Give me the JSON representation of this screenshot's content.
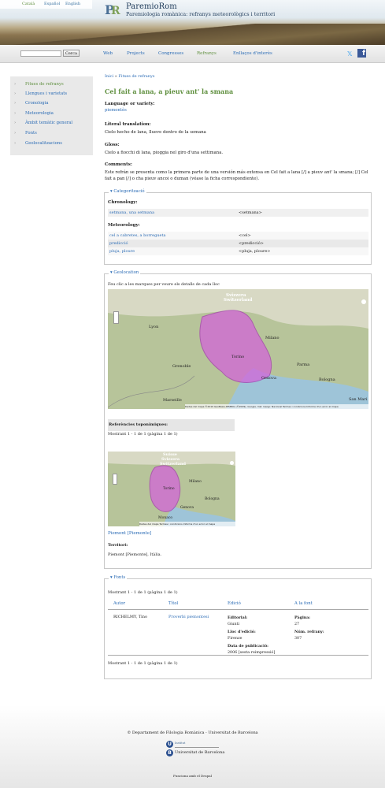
{
  "langs": [
    "Català",
    "Español",
    "English"
  ],
  "site": {
    "name": "ParemioRom",
    "slogan": "Paremiologia romànica: refranys meteorològics i territori"
  },
  "search_button": "Cerca",
  "nav": [
    "Web",
    "Projects",
    "Congresses",
    "Refranys",
    "Enllaços d'interès"
  ],
  "social": {
    "twitter": "ὂ6",
    "facebook": "f"
  },
  "sidebar": [
    "Fitxes de refranys",
    "Llengues i varietats",
    "Cronologia",
    "Meteorologia",
    "Àmbit temàtic general",
    "Fonts",
    "Geolocalitzacions"
  ],
  "breadcrumb": {
    "home": "Inici",
    "sep": "»",
    "current": "Fitxes de refranys"
  },
  "title": "Cel fait a lana, a pieuv ant' la smana",
  "lang_label": "Language or variety:",
  "lang_value": "piemontès",
  "literal_label": "Literal translation:",
  "literal_value": "Cielo hecho de lana, llueve dentro de la semana",
  "gloss_label": "Gloss:",
  "gloss_value": "Cielo a fiocchi di lana, pioggia nel giro d'una settimana.",
  "comments_label": "Comments:",
  "comments_value": "Este refrán se presenta como la primera parte de una versión más extensa en Cel fait a lana [/] a pieuv ant' la smana; [/] Cel fait a pan [/] o cha pieuv ancoi o duman (véase la ficha correspondiente).",
  "categ": {
    "legend": "Categorització",
    "chrono_label": "Chronology:",
    "chrono_row": [
      "setmana, una setmana",
      "<setmana>"
    ],
    "meteo_label": "Meteorology:",
    "meteo_rows": [
      [
        "cel a cabretes, a borregueta",
        "<cel>"
      ],
      [
        "predicció",
        "<predicció>"
      ],
      [
        "pluja, ploure",
        "<pluja, ploure>"
      ]
    ]
  },
  "geo": {
    "legend": "Geolocation",
    "hint": "Feu clic a les marques per veure els detalls de cada lloc",
    "map_labels": [
      "Svizzera",
      "Switzerland",
      "Milano",
      "Lyon",
      "Torino",
      "Genova",
      "Parma",
      "Bologna",
      "Grenoble",
      "Marseille",
      "San Mari"
    ],
    "map_credit": "Dades del mapa ©2019 GeoBasis-DE/BKG (©2009), Google, Inst. Geogr. Nacional   Termes i condicions   Informa d'un error al mapa",
    "refs_header": "Referències toponímiques:",
    "showing": "Mostrant 1 - 1 de 1 (pàgina 1 de 1)",
    "small_map_labels": [
      "Suisse",
      "Svizzera",
      "Switzerland",
      "Milano",
      "Torino",
      "Genova",
      "Bologna",
      "Monaco"
    ],
    "small_credit": "Dades del mapa   Termes i condicions   Informa d'un error al mapa",
    "place_link": "Piemont [Piemonte]",
    "territory_label": "Territori:",
    "territory_value": "Piemont [Piemonte], Itàlia."
  },
  "fonts": {
    "legend": "Fonts",
    "showing": "Mostrant 1 - 1 de 1 (pàgina 1 de 1)",
    "headers": [
      "Autor",
      "Títol",
      "Edició",
      "A la font"
    ],
    "author": "RICHELMY, Tino",
    "work": "Proverbi piemontesi",
    "ed_lines": [
      [
        "Editorial:",
        ""
      ],
      [
        "Giunti",
        ""
      ],
      [
        "Lloc d'edició:",
        ""
      ],
      [
        "Firenze",
        ""
      ],
      [
        "Data de publicació:",
        ""
      ],
      [
        "2006 [sesta reimpressió]",
        ""
      ]
    ],
    "src_lines": [
      [
        "Pàgina:",
        ""
      ],
      [
        "27",
        ""
      ],
      [
        "Núm. refrany:",
        ""
      ],
      [
        "307",
        ""
      ]
    ],
    "showing2": "Mostrant 1 - 1 de 1 (pàgina 1 de 1)"
  },
  "footer": {
    "dept": "© Departament de Filologia Romànica - Universitat de Barcelona",
    "univ_small": "Institut",
    "univ": "Universitat de Barcelona",
    "drupal": "Funciona amb el Drupal"
  }
}
